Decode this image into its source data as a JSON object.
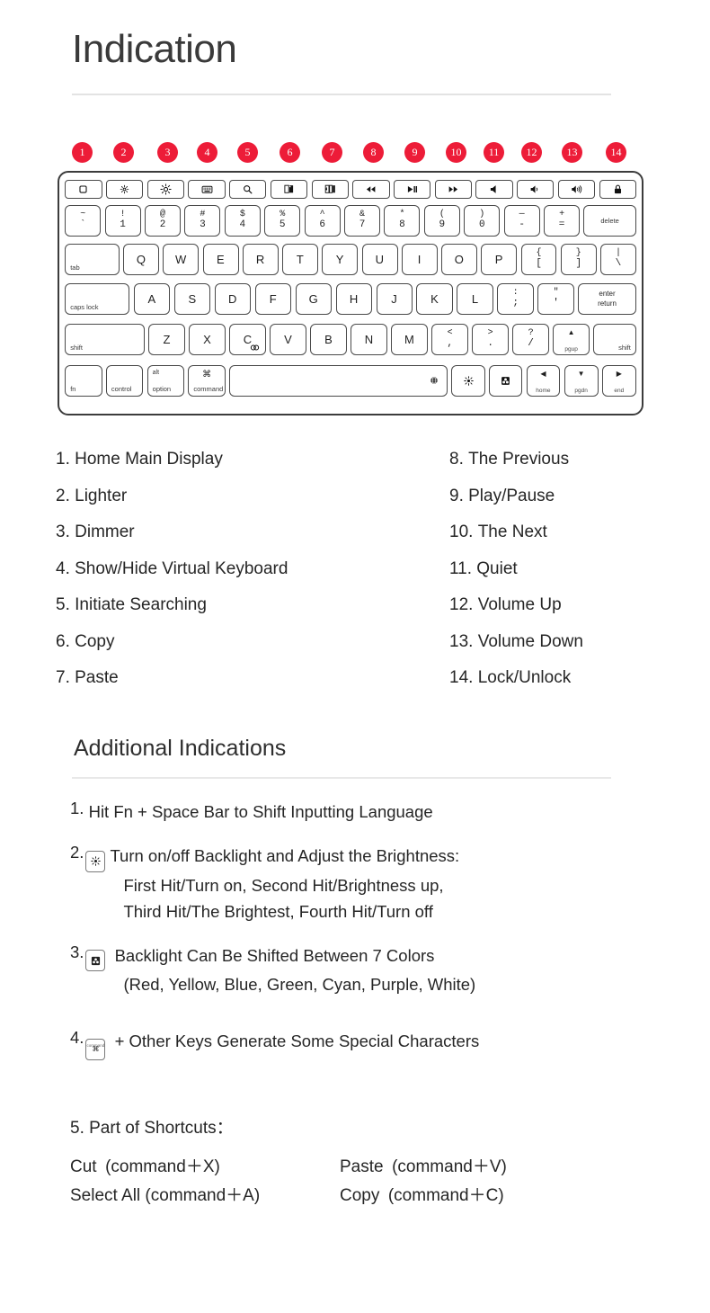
{
  "page": {
    "title": "Indication",
    "subtitle": "Additional Indications"
  },
  "badges": [
    "1",
    "2",
    "3",
    "4",
    "5",
    "6",
    "7",
    "8",
    "9",
    "10",
    "11",
    "12",
    "13",
    "14"
  ],
  "keyboard": {
    "function_row": [
      {
        "icon": "home-icon",
        "name": "home"
      },
      {
        "icon": "brightness-down-icon",
        "name": "lighter"
      },
      {
        "icon": "brightness-up-icon",
        "name": "dimmer"
      },
      {
        "icon": "virtual-keyboard-icon",
        "name": "virtual-keyboard"
      },
      {
        "icon": "search-icon",
        "name": "search"
      },
      {
        "icon": "copy-icon",
        "name": "copy"
      },
      {
        "icon": "paste-icon",
        "name": "paste"
      },
      {
        "icon": "rewind-icon",
        "name": "previous"
      },
      {
        "icon": "play-pause-icon",
        "name": "play-pause"
      },
      {
        "icon": "fast-forward-icon",
        "name": "next"
      },
      {
        "icon": "mute-icon",
        "name": "quiet"
      },
      {
        "icon": "volume-down-icon",
        "name": "volume-up"
      },
      {
        "icon": "volume-up-icon",
        "name": "volume-down"
      },
      {
        "icon": "lock-icon",
        "name": "lock-unlock"
      }
    ],
    "number_row": [
      {
        "upper": "~",
        "lower": "`"
      },
      {
        "upper": "!",
        "lower": "1"
      },
      {
        "upper": "@",
        "lower": "2"
      },
      {
        "upper": "#",
        "lower": "3"
      },
      {
        "upper": "$",
        "lower": "4"
      },
      {
        "upper": "%",
        "lower": "5"
      },
      {
        "upper": "^",
        "lower": "6"
      },
      {
        "upper": "&",
        "lower": "7"
      },
      {
        "upper": "*",
        "lower": "8"
      },
      {
        "upper": "(",
        "lower": "9"
      },
      {
        "upper": ")",
        "lower": "0"
      },
      {
        "upper": "—",
        "lower": "-"
      },
      {
        "upper": "+",
        "lower": "="
      }
    ],
    "delete_label": "delete",
    "tab_label": "tab",
    "qwerty_row": [
      "Q",
      "W",
      "E",
      "R",
      "T",
      "Y",
      "U",
      "I",
      "O",
      "P"
    ],
    "qwerty_tail": [
      {
        "upper": "{",
        "lower": "["
      },
      {
        "upper": "}",
        "lower": "]"
      },
      {
        "upper": "|",
        "lower": "\\"
      }
    ],
    "caps_label": "caps lock",
    "asdf_row": [
      "A",
      "S",
      "D",
      "F",
      "G",
      "H",
      "J",
      "K",
      "L"
    ],
    "asdf_tail": [
      {
        "upper": ":",
        "lower": ";"
      },
      {
        "upper": "\"",
        "lower": "'"
      }
    ],
    "enter_label_top": "enter",
    "enter_label_bottom": "return",
    "shift_label": "shift",
    "zxcv_row": [
      "Z",
      "X",
      "C",
      "V",
      "B",
      "N",
      "M"
    ],
    "zxcv_tail": [
      {
        "upper": "<",
        "lower": ","
      },
      {
        "upper": ">",
        "lower": "."
      },
      {
        "upper": "?",
        "lower": "/"
      }
    ],
    "pgup_label": "pgup",
    "pgdn_label": "pgdn",
    "home_label": "home",
    "end_label": "end",
    "fn_label": "fn",
    "control_label": "control",
    "option_upper": "alt",
    "option_label": "option",
    "command_symbol": "⌘",
    "command_label": "command"
  },
  "indications": {
    "left": [
      {
        "num": "1.",
        "text": "Home Main Display"
      },
      {
        "num": "2.",
        "text": "Lighter"
      },
      {
        "num": "3.",
        "text": "Dimmer"
      },
      {
        "num": "4.",
        "text": "Show/Hide Virtual Keyboard"
      },
      {
        "num": "5.",
        "text": "Initiate Searching"
      },
      {
        "num": "6.",
        "text": "Copy"
      },
      {
        "num": "7.",
        "text": "Paste"
      }
    ],
    "right": [
      {
        "num": "8.",
        "text": "The Previous"
      },
      {
        "num": "9.",
        "text": "Play/Pause"
      },
      {
        "num": "10.",
        "text": "The Next"
      },
      {
        "num": "11.",
        "text": "Quiet"
      },
      {
        "num": "12.",
        "text": "Volume Up"
      },
      {
        "num": "13.",
        "text": "Volume Down"
      },
      {
        "num": "14.",
        "text": "Lock/Unlock"
      }
    ]
  },
  "additional": {
    "item1_num": "1.",
    "item1": "Hit Fn + Space Bar to Shift Inputting Language",
    "item2_num": "2.",
    "item2_line1": "Turn on/off Backlight and Adjust the Brightness:",
    "item2_line2": "First Hit/Turn on, Second Hit/Brightness up,",
    "item2_line3": "Third Hit/The Brightest, Fourth Hit/Turn off",
    "item3_num": "3.",
    "item3_line1": "Backlight Can Be Shifted Between 7 Colors",
    "item3_line2": "(Red, Yellow, Blue, Green, Cyan, Purple, White)",
    "item4_num": "4.",
    "item4_line1": "+ Other Keys Generate Some Special Characters",
    "item4_key_label": "command",
    "item4_key_symbol": "⌘"
  },
  "shortcuts": {
    "heading": "5. Part of Shortcuts：",
    "rows": [
      {
        "a": "Cut (command＋X)",
        "b": "Paste (command＋V)"
      },
      {
        "a": "Select All (command＋A)",
        "b": "Copy (command＋C)"
      }
    ]
  },
  "colors": {
    "badge": "#ed1c38",
    "text": "#262626",
    "rule": "#e3e3e3",
    "key_border": "#4a4a4a"
  }
}
